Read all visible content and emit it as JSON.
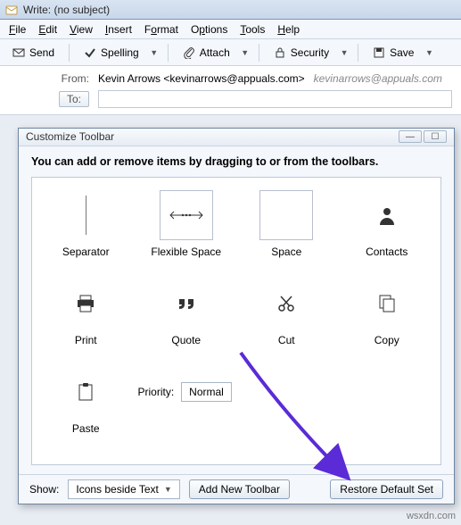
{
  "window": {
    "title": "Write: (no subject)"
  },
  "menu": {
    "file": "File",
    "edit": "Edit",
    "view": "View",
    "insert": "Insert",
    "format": "Format",
    "options": "Options",
    "tools": "Tools",
    "help": "Help"
  },
  "toolbar": {
    "send": "Send",
    "spelling": "Spelling",
    "attach": "Attach",
    "security": "Security",
    "save": "Save"
  },
  "addr": {
    "from_label": "From:",
    "from_value": "Kevin Arrows <kevinarrows@appuals.com>",
    "from_grey": "kevinarrows@appuals.com",
    "to_label": "To:"
  },
  "dialog": {
    "title": "Customize Toolbar",
    "instructions": "You can add or remove items by dragging to or from the toolbars.",
    "items": {
      "separator": "Separator",
      "flexspace": "Flexible Space",
      "space": "Space",
      "contacts": "Contacts",
      "print": "Print",
      "quote": "Quote",
      "cut": "Cut",
      "copy": "Copy",
      "paste": "Paste"
    },
    "priority_label": "Priority:",
    "priority_value": "Normal",
    "show_label": "Show:",
    "show_value": "Icons beside Text",
    "add_btn": "Add New Toolbar",
    "restore_btn": "Restore Default Set"
  },
  "watermark": "wsxdn.com"
}
